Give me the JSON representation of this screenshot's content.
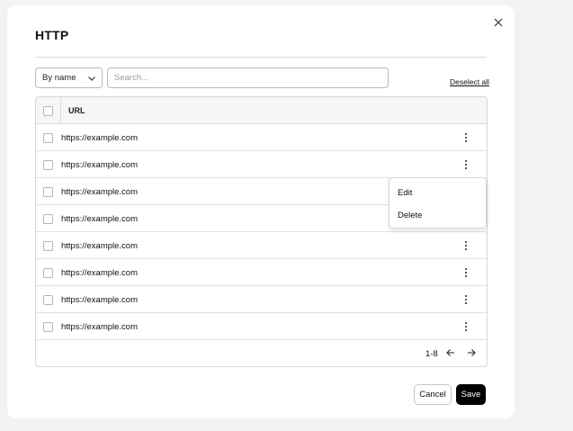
{
  "dialog": {
    "title": "HTTP",
    "close_icon": "close-icon"
  },
  "toolbar": {
    "filter_selected": "By name",
    "search_placeholder": "Search...",
    "search_value": "",
    "deselect_all_label": "Deselect all"
  },
  "table": {
    "header": {
      "url": "URL"
    },
    "rows": [
      {
        "url": "https://example.com",
        "checked": false
      },
      {
        "url": "https://example.com",
        "checked": false
      },
      {
        "url": "https://example.com",
        "checked": false
      },
      {
        "url": "https://example.com",
        "checked": false
      },
      {
        "url": "https://example.com",
        "checked": false
      },
      {
        "url": "https://example.com",
        "checked": false
      },
      {
        "url": "https://example.com",
        "checked": false
      },
      {
        "url": "https://example.com",
        "checked": false
      }
    ],
    "pagination": {
      "range": "1-8"
    }
  },
  "context_menu": {
    "items": [
      {
        "label": "Edit"
      },
      {
        "label": "Delete"
      }
    ]
  },
  "footer": {
    "cancel_label": "Cancel",
    "save_label": "Save"
  }
}
